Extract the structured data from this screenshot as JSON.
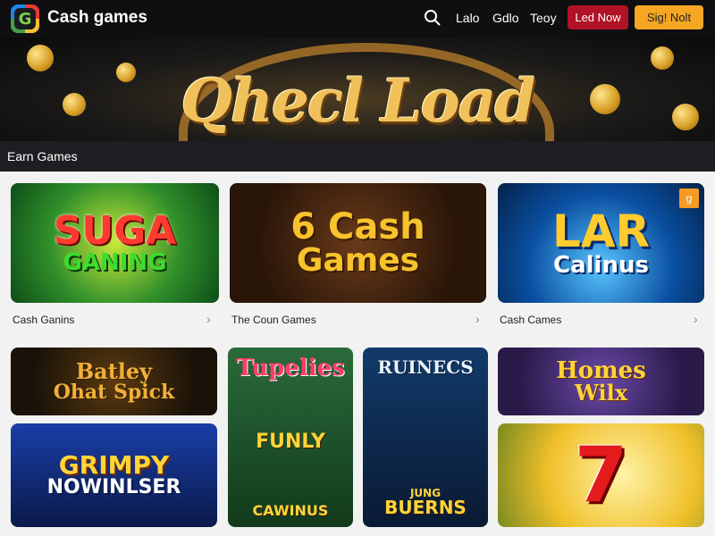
{
  "header": {
    "logo_letter": "G",
    "title": "Cash games",
    "nav": [
      "Lalo",
      "Gdlo",
      "Teoy"
    ],
    "btn_primary": "Led Now",
    "btn_secondary": "Sig! Nolt",
    "search_icon": "search-icon"
  },
  "banner": {
    "title": "Qhecl Load"
  },
  "section": {
    "title": "Earn Games"
  },
  "featured": [
    {
      "art_line1": "SUGA",
      "art_line2": "GANING",
      "caption": "Cash Ganins"
    },
    {
      "art_line1": "6 Cash",
      "art_line2": "Games",
      "caption": "The Coun Games"
    },
    {
      "art_line1": "LAR",
      "art_line2": "Calinus",
      "caption": "Cash Cames",
      "badge": "g"
    }
  ],
  "tiles": [
    {
      "line1": "Batley",
      "line2": "Ohat Spick"
    },
    {
      "line1": "GRIMPY",
      "line2": "NOWINLSER"
    },
    {
      "line1": "Tupelies",
      "line2": "FUNLY",
      "line3": "CAWINUS"
    },
    {
      "line1": "RUINECS",
      "line2": "JUNG",
      "line3": "BUERNS"
    },
    {
      "line1": "Homes",
      "line2": "Wilx"
    },
    {
      "line1": "7"
    }
  ],
  "colors": {
    "header_bg": "#0f0f12",
    "primary": "#b11226",
    "secondary": "#f5a623",
    "section_bg": "#1e1e22"
  }
}
